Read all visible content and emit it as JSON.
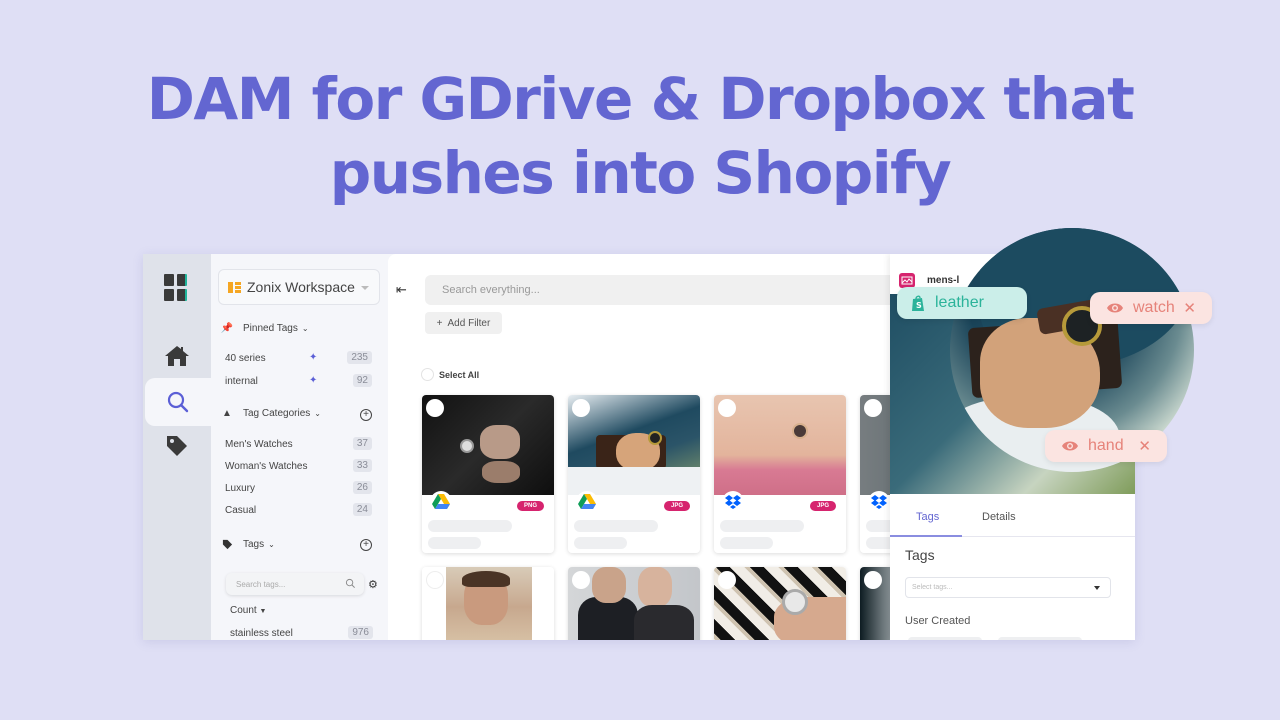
{
  "headline": {
    "line1": "DAM for GDrive & Dropbox that",
    "line2": "pushes into Shopify"
  },
  "colors": {
    "background": "#dfdff5",
    "accent": "#6366d1",
    "file_badge": "#d6246e",
    "shopify_chip_bg": "#cbeee9",
    "shopify_chip_text": "#2bb39a",
    "ai_chip_bg": "#fbe4e1",
    "ai_chip_text": "#e6837a"
  },
  "rail": {
    "items": [
      {
        "name": "logo",
        "icon": "grid-logo-icon"
      },
      {
        "name": "home",
        "icon": "home-icon"
      },
      {
        "name": "search",
        "icon": "search-icon",
        "active": true
      },
      {
        "name": "tags",
        "icon": "tag-icon"
      }
    ]
  },
  "sidebar": {
    "workspace": "Zonix Workspace",
    "pinned_tags": {
      "title": "Pinned Tags",
      "items": [
        {
          "label": "40 series",
          "count": "235"
        },
        {
          "label": "internal",
          "count": "92"
        }
      ]
    },
    "tag_categories": {
      "title": "Tag Categories",
      "items": [
        {
          "label": "Men's Watches",
          "count": "37"
        },
        {
          "label": "Woman's Watches",
          "count": "33"
        },
        {
          "label": "Luxury",
          "count": "26"
        },
        {
          "label": "Casual",
          "count": "24"
        }
      ]
    },
    "tags": {
      "title": "Tags",
      "search_placeholder": "Search tags...",
      "sort_label": "Count",
      "items": [
        {
          "label": "stainless steel",
          "count": "976"
        }
      ]
    }
  },
  "main": {
    "search_placeholder": "Search everything...",
    "add_filter": "Add Filter",
    "select_all": "Select All",
    "cards": [
      {
        "source": "google-drive",
        "type": "PNG"
      },
      {
        "source": "google-drive",
        "type": "JPG"
      },
      {
        "source": "dropbox",
        "type": "JPG"
      },
      {
        "source": "dropbox",
        "type": ""
      },
      {
        "source": "",
        "type": ""
      },
      {
        "source": "",
        "type": ""
      },
      {
        "source": "",
        "type": ""
      },
      {
        "source": "",
        "type": ""
      }
    ]
  },
  "panel": {
    "file_name": "mens-l",
    "tabs": [
      {
        "label": "Tags",
        "active": true
      },
      {
        "label": "Details",
        "active": false
      }
    ],
    "tags_title": "Tags",
    "select_tags_placeholder": "Select tags...",
    "user_created": "User Created"
  },
  "chips": {
    "shopify": {
      "label": "leather",
      "icon": "shopify-icon"
    },
    "ai": [
      {
        "label": "watch",
        "icon": "eye-icon"
      },
      {
        "label": "hand",
        "icon": "eye-icon"
      }
    ]
  }
}
